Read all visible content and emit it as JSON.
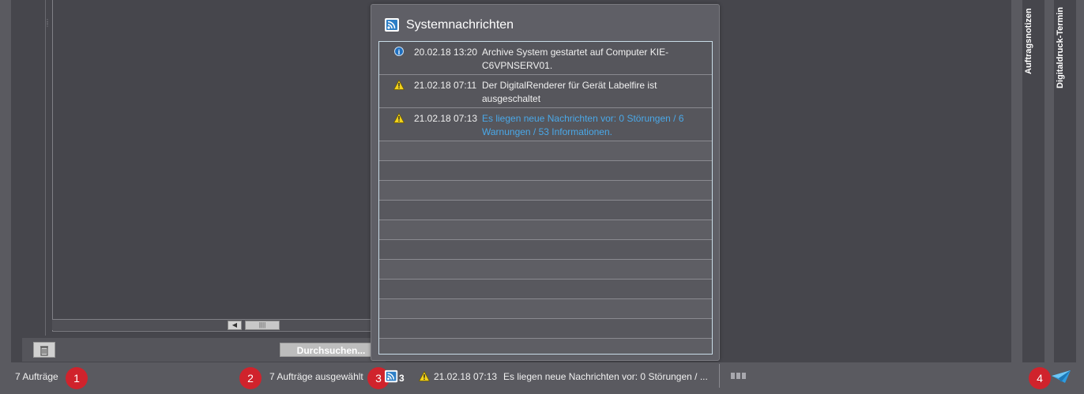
{
  "popup": {
    "title": "Systemnachrichten",
    "messages": [
      {
        "type": "info",
        "time": "20.02.18 13:20",
        "text": "Archive System gestartet auf Computer KIE-C6VPNSERV01."
      },
      {
        "type": "warning",
        "time": "21.02.18 07:11",
        "text": "Der DigitalRenderer für Gerät Labelfire ist ausgeschaltet"
      },
      {
        "type": "warning",
        "time": "21.02.18 07:13",
        "text": "Es liegen neue Nachrichten vor: 0 Störungen / 6 Warnungen / 53 Informationen."
      }
    ]
  },
  "left_panel": {
    "browse_label": "Durchsuchen...",
    "trash_icon": "trash-icon"
  },
  "side_tabs": [
    "Auftragsnotizen",
    "Digitaldruck-Termin"
  ],
  "status": {
    "orders": "7 Aufträge",
    "selected": "7 Aufträge ausgewählt",
    "message_count": "3",
    "last_time": "21.02.18 07:13",
    "last_message": "Es liegen neue Nachrichten vor: 0 Störungen / ..."
  },
  "badges": [
    "1",
    "2",
    "3",
    "4"
  ],
  "colors": {
    "badge": "#d0232c",
    "link": "#4aa8e8",
    "info": "#1f6fbf",
    "warning": "#f2d21b"
  }
}
